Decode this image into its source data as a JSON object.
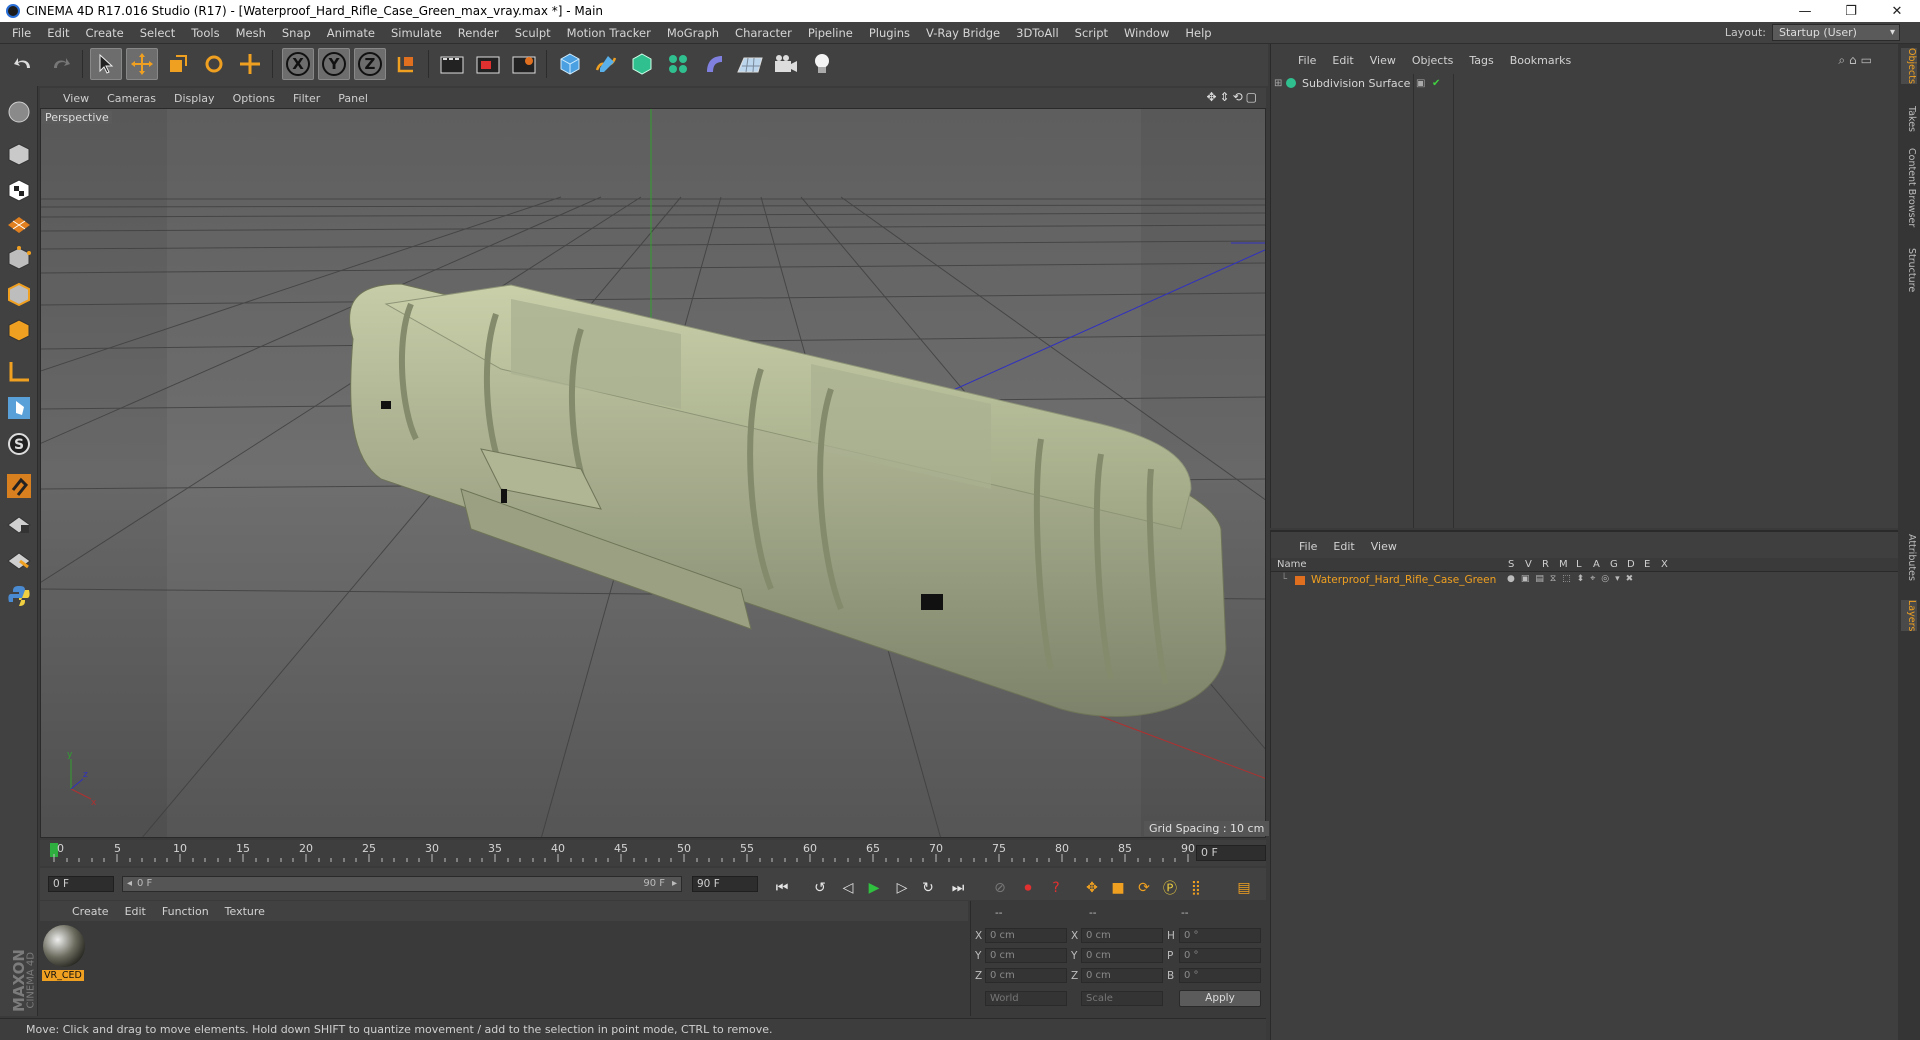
{
  "window": {
    "title": "CINEMA 4D R17.016 Studio (R17) - [Waterproof_Hard_Rifle_Case_Green_max_vray.max *] - Main",
    "buttons": [
      "—",
      "❐",
      "✕"
    ]
  },
  "menubar": {
    "items": [
      "File",
      "Edit",
      "Create",
      "Select",
      "Tools",
      "Mesh",
      "Snap",
      "Animate",
      "Simulate",
      "Render",
      "Sculpt",
      "Motion Tracker",
      "MoGraph",
      "Character",
      "Pipeline",
      "Plugins",
      "V-Ray Bridge",
      "3DToAll",
      "Script",
      "Window",
      "Help"
    ],
    "layout_label": "Layout:",
    "layout_value": "Startup (User)"
  },
  "toolbar": {
    "axis_x": "X",
    "axis_y": "Y",
    "axis_z": "Z"
  },
  "viewport": {
    "menu": [
      "View",
      "Cameras",
      "Display",
      "Options",
      "Filter",
      "Panel"
    ],
    "camera_label": "Perspective",
    "grid_spacing": "Grid Spacing : 10 cm"
  },
  "timeline": {
    "ticks": [
      "0",
      "5",
      "10",
      "15",
      "20",
      "25",
      "30",
      "35",
      "40",
      "45",
      "50",
      "55",
      "60",
      "65",
      "70",
      "75",
      "80",
      "85",
      "90"
    ],
    "current_frame": "0 F",
    "start_frame": "0 F",
    "range_start": "0 F",
    "range_end": "90 F",
    "end_frame": "90 F"
  },
  "material_manager": {
    "menu": [
      "Create",
      "Edit",
      "Function",
      "Texture"
    ],
    "materials": [
      {
        "name": "VR_CED"
      }
    ]
  },
  "coordinates": {
    "header": [
      "--",
      "--",
      "--"
    ],
    "rows": [
      {
        "axis": "X",
        "pos": "0 cm",
        "axis2": "X",
        "size": "0 cm",
        "rot_label": "H",
        "rot": "0 °"
      },
      {
        "axis": "Y",
        "pos": "0 cm",
        "axis2": "Y",
        "size": "0 cm",
        "rot_label": "P",
        "rot": "0 °"
      },
      {
        "axis": "Z",
        "pos": "0 cm",
        "axis2": "Z",
        "size": "0 cm",
        "rot_label": "B",
        "rot": "0 °"
      }
    ],
    "mode": "World",
    "scale": "Scale",
    "apply": "Apply"
  },
  "status": {
    "text": "Move: Click and drag to move elements. Hold down SHIFT to quantize movement / add to the selection in point mode, CTRL to remove."
  },
  "branding": {
    "line1": "MAXON",
    "line2": "CINEMA 4D"
  },
  "object_manager": {
    "menu": [
      "File",
      "Edit",
      "View",
      "Objects",
      "Tags",
      "Bookmarks"
    ],
    "objects": [
      {
        "name": "Subdivision Surface"
      }
    ]
  },
  "layer_manager": {
    "menu": [
      "File",
      "Edit",
      "View"
    ],
    "name_header": "Name",
    "columns": [
      "S",
      "V",
      "R",
      "M",
      "L",
      "A",
      "G",
      "D",
      "E",
      "X"
    ],
    "layers": [
      {
        "name": "Waterproof_Hard_Rifle_Case_Green",
        "color": "#e07020"
      }
    ]
  },
  "side_tabs": [
    "Objects",
    "Takes",
    "Content Browser",
    "Structure",
    "Attributes",
    "Layers"
  ]
}
